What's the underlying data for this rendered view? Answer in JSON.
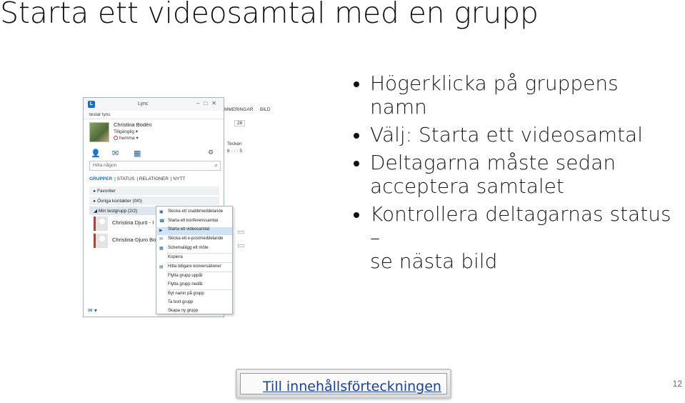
{
  "slide": {
    "title": "Starta ett videosamtal med en grupp",
    "page_number": "12",
    "link_label": "Till innehållsförteckningen"
  },
  "bullets": [
    {
      "line1": "Högerklicka på gruppens namn",
      "line2": ""
    },
    {
      "line1": "Välj: Starta ett videosamtal",
      "line2": ""
    },
    {
      "line1": "Deltagarna måste sedan",
      "line2": "acceptera samtalet"
    },
    {
      "line1": "Kontrollera deltagarnas status –",
      "line2": "se nästa bild"
    }
  ],
  "lync": {
    "window_title": "Lync",
    "note": "testar lync",
    "user_name": "Christina Bodén",
    "status": "Tillgänglig ▾",
    "location": "hemma ▾",
    "search_placeholder": "Hitta någon",
    "tabs": [
      "GRUPPER",
      "STATUS",
      "RELATIONER",
      "NYTT"
    ],
    "groups": [
      "Favoriter",
      "Övriga kontakter (0/0)",
      "Min testgrupp (2/2)"
    ],
    "contacts": [
      "Christina Djurö - I",
      "Christina-Djuro Bo"
    ]
  },
  "ribbon": {
    "tab1": "MMERINGAR",
    "tab2": "BILD",
    "size": "28",
    "section": "Tecken",
    "ruler": "6 · · · 5"
  },
  "context_menu": {
    "items": [
      "Skicka ett snabbmeddelande",
      "Starta ett konferenssamtal",
      "Starta ett videosamtal",
      "Skicka ett e-postmeddelande",
      "Schemalägg ett möte",
      "Kopiera",
      "Hitta tidigare konversationer",
      "Flytta grupp uppåt",
      "Flytta grupp nedåt",
      "Byt namn på grupp",
      "Ta bort grupp",
      "Skapa ny grupp"
    ],
    "highlighted_index": 2,
    "highlight_color": "#cfe3f6"
  },
  "colors": {
    "link": "#1a3fa8",
    "lync_accent": "#1a6ec2"
  }
}
